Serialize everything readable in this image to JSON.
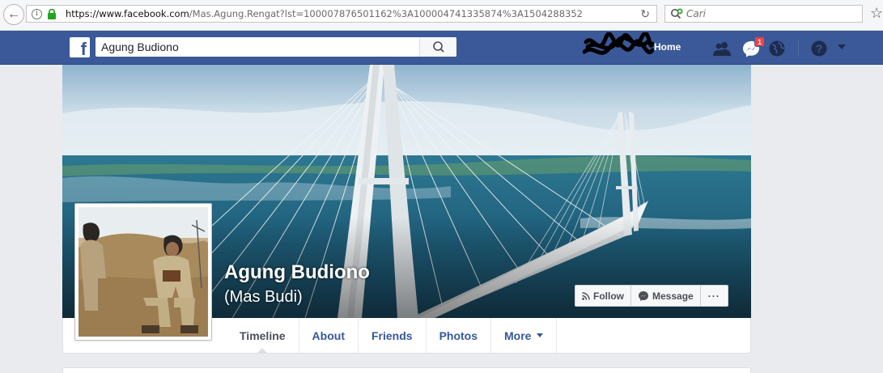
{
  "browser": {
    "url_host": "https://www.facebook.com",
    "url_path": "/Mas.Agung.Rengat?lst=100007876501162%3A100004741335874%3A1504288352",
    "search_placeholder": "Cari"
  },
  "topbar": {
    "search_value": "Agung Budiono",
    "home_label": "Home",
    "messages_badge": "1",
    "colors": {
      "bar": "#3b5998",
      "badge": "#fa3e3e"
    }
  },
  "profile": {
    "name": "Agung Budiono",
    "alternate_name": "(Mas Budi)"
  },
  "cover_actions": {
    "follow_label": "Follow",
    "message_label": "Message",
    "more_label": "···"
  },
  "tabs": [
    {
      "label": "Timeline",
      "active": true
    },
    {
      "label": "About"
    },
    {
      "label": "Friends"
    },
    {
      "label": "Photos"
    },
    {
      "label": "More"
    }
  ],
  "icons": [
    "back-arrow-icon",
    "info-icon",
    "lock-icon",
    "reload-icon",
    "search-engine-icon",
    "bookmark-star-icon",
    "facebook-logo-icon",
    "magnifier-icon",
    "friends-icon",
    "messages-icon",
    "globe-icon",
    "help-icon",
    "caret-down-icon",
    "rss-icon",
    "messenger-icon"
  ]
}
